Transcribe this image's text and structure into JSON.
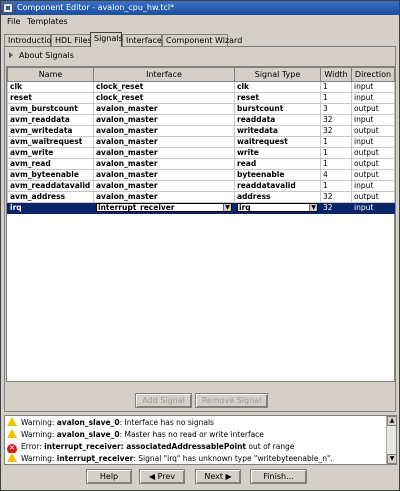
{
  "window": {
    "title": "Component Editor - avalon_cpu_hw.tcl*"
  },
  "menu": {
    "file": "File",
    "templates": "Templates"
  },
  "tabs": [
    "Introduction",
    "HDL Files",
    "Signals",
    "Interfaces",
    "Component Wizard"
  ],
  "about": {
    "label": "About Signals"
  },
  "columns": [
    "Name",
    "Interface",
    "Signal Type",
    "Width",
    "Direction"
  ],
  "rows": [
    {
      "name": "clk",
      "interface": "clock_reset",
      "type": "clk",
      "width": "1",
      "direction": "input"
    },
    {
      "name": "reset",
      "interface": "clock_reset",
      "type": "reset",
      "width": "1",
      "direction": "input"
    },
    {
      "name": "avm_burstcount",
      "interface": "avalon_master",
      "type": "burstcount",
      "width": "3",
      "direction": "output"
    },
    {
      "name": "avm_readdata",
      "interface": "avalon_master",
      "type": "readdata",
      "width": "32",
      "direction": "input"
    },
    {
      "name": "avm_writedata",
      "interface": "avalon_master",
      "type": "writedata",
      "width": "32",
      "direction": "output"
    },
    {
      "name": "avm_waitrequest",
      "interface": "avalon_master",
      "type": "waitrequest",
      "width": "1",
      "direction": "input"
    },
    {
      "name": "avm_write",
      "interface": "avalon_master",
      "type": "write",
      "width": "1",
      "direction": "output"
    },
    {
      "name": "avm_read",
      "interface": "avalon_master",
      "type": "read",
      "width": "1",
      "direction": "output"
    },
    {
      "name": "avm_byteenable",
      "interface": "avalon_master",
      "type": "byteenable",
      "width": "4",
      "direction": "output"
    },
    {
      "name": "avm_readdatavalid",
      "interface": "avalon_master",
      "type": "readdatavalid",
      "width": "1",
      "direction": "input"
    },
    {
      "name": "avm_address",
      "interface": "avalon_master",
      "type": "address",
      "width": "32",
      "direction": "output"
    },
    {
      "name": "irq",
      "interface": "interrupt_receiver",
      "type": "irq",
      "width": "32",
      "direction": "input"
    }
  ],
  "buttons": {
    "add_signal": "Add Signal",
    "remove_signal": "Remove Signal"
  },
  "messages": [
    {
      "kind": "warning",
      "prefix": "Warning: ",
      "subject": "avalon_slave_0",
      "text": ": Interface has no signals"
    },
    {
      "kind": "warning",
      "prefix": "Warning: ",
      "subject": "avalon_slave_0",
      "text": ": Master has no read or write interface"
    },
    {
      "kind": "error",
      "prefix": "Error: ",
      "subject": "interrupt_receiver: associatedAddressablePoint",
      "text": " out of range"
    },
    {
      "kind": "warning",
      "prefix": "Warning: ",
      "subject": "interrupt_receiver",
      "text": ": Signal \"irq\" has unknown type \"writebyteenable_n\"."
    }
  ],
  "footer": {
    "help": "Help",
    "prev": "Prev",
    "next": "Next",
    "finish": "Finish..."
  }
}
